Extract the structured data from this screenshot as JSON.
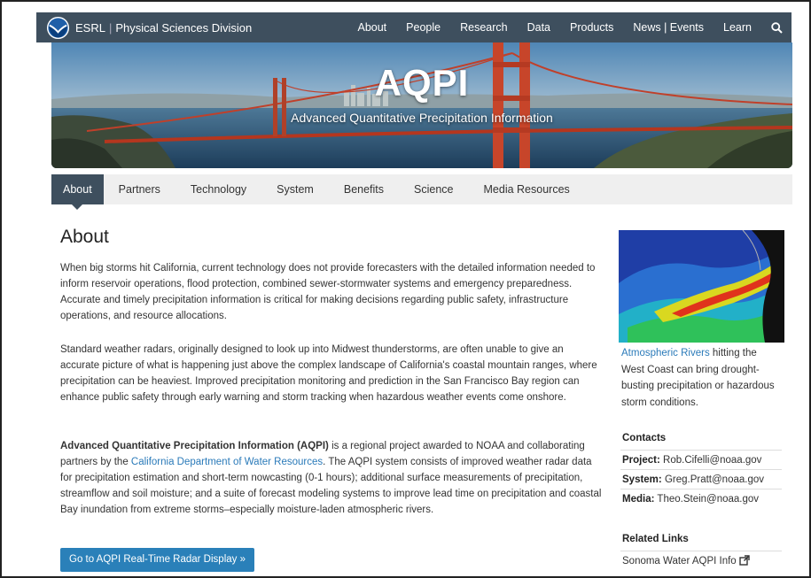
{
  "navbar": {
    "brand_org": "ESRL",
    "brand_sep": "|",
    "brand_division": "Physical Sciences Division",
    "links": [
      "About",
      "People",
      "Research",
      "Data",
      "Products",
      "News | Events",
      "Learn"
    ],
    "search_icon": "search-icon"
  },
  "hero": {
    "title": "AQPI",
    "subtitle": "Advanced Quantitative Precipitation Information"
  },
  "tabs": [
    "About",
    "Partners",
    "Technology",
    "System",
    "Benefits",
    "Science",
    "Media Resources"
  ],
  "main": {
    "heading": "About",
    "para1": "When big storms hit California, current technology does not provide forecasters with the detailed information needed to inform reservoir operations, flood protection, combined sewer-stormwater systems and emergency preparedness. Accurate and timely precipitation information is critical for making decisions regarding public safety, infrastructure operations, and resource allocations.",
    "para2": "Standard weather radars, originally designed to look up into Midwest thunderstorms, are often unable to give an accurate picture of what is happening just above the complex landscape of California's coastal mountain ranges, where precipitation can be heaviest. Improved precipitation monitoring and prediction in the San Francisco Bay region can enhance public safety through early warning and storm tracking when hazardous weather events come onshore.",
    "para3_bold": "Advanced Quantitative Precipitation Information (AQPI)",
    "para3_a": " is a regional project awarded to NOAA and collaborating partners by the ",
    "para3_link": "California Department of Water Resources",
    "para3_b": ". The AQPI system consists of improved weather radar data for precipitation estimation and short-term nowcasting (0-1 hours); additional surface measurements of precipitation, streamflow and soil moisture; and a suite of forecast modeling systems to improve lead time on precipitation and coastal Bay inundation from extreme storms–especially moisture-laden atmospheric rivers.",
    "cta_label": "Go to AQPI Real-Time Radar Display »"
  },
  "sidebar": {
    "caption_link": "Atmospheric Rivers",
    "caption_text": " hitting the West Coast can bring drought-busting precipitation or hazardous storm conditions.",
    "contacts_heading": "Contacts",
    "contacts": [
      {
        "role": "Project:",
        "email": "Rob.Cifelli@noaa.gov"
      },
      {
        "role": "System:",
        "email": "Greg.Pratt@noaa.gov"
      },
      {
        "role": "Media:",
        "email": "Theo.Stein@noaa.gov"
      }
    ],
    "links_heading": "Related Links",
    "links": [
      "Sonoma Water AQPI Info"
    ]
  },
  "colors": {
    "navbar": "#3e4f5e",
    "accent": "#2a80b9",
    "link": "#2a7ab9",
    "tab_bar": "#efefef"
  }
}
